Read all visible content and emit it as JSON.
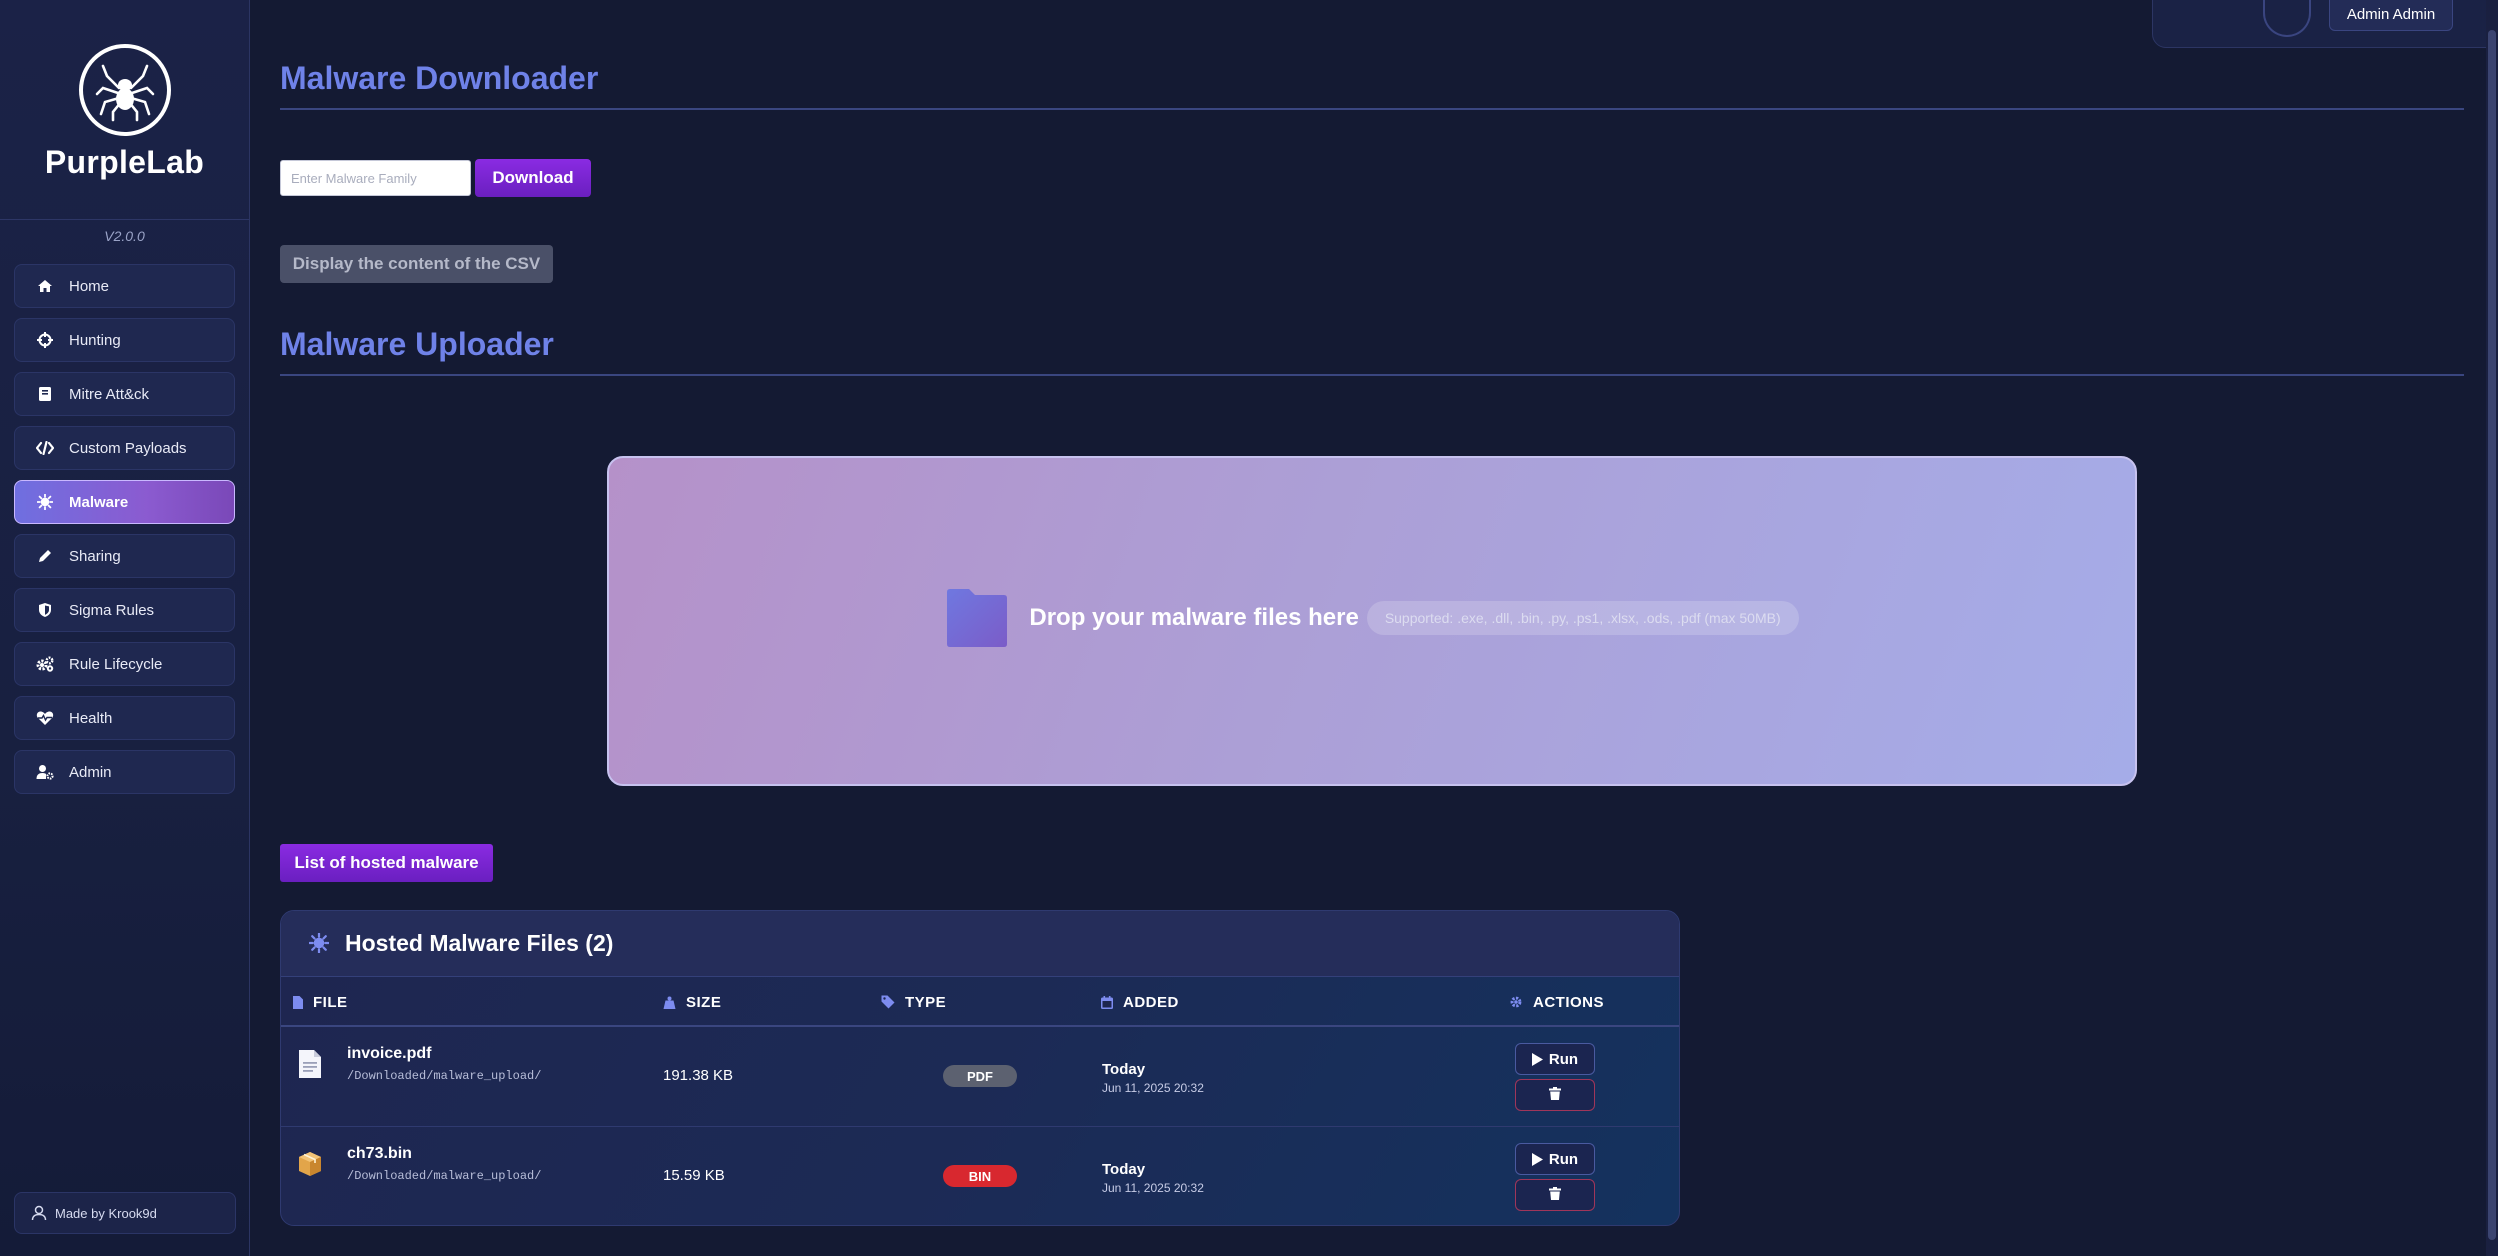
{
  "app": {
    "name": "PurpleLab",
    "version": "V2.0.0",
    "footer": "Made by Krook9d"
  },
  "user": {
    "button_label": "Admin Admin"
  },
  "sidebar": {
    "items": [
      {
        "label": "Home",
        "icon": "home-icon"
      },
      {
        "label": "Hunting",
        "icon": "crosshair-icon"
      },
      {
        "label": "Mitre Att&ck",
        "icon": "book-icon"
      },
      {
        "label": "Custom Payloads",
        "icon": "code-icon"
      },
      {
        "label": "Malware",
        "icon": "virus-icon",
        "active": true
      },
      {
        "label": "Sharing",
        "icon": "pencil-icon"
      },
      {
        "label": "Sigma Rules",
        "icon": "shield-icon"
      },
      {
        "label": "Rule Lifecycle",
        "icon": "cogs-icon"
      },
      {
        "label": "Health",
        "icon": "heartbeat-icon"
      },
      {
        "label": "Admin",
        "icon": "user-cog-icon"
      }
    ]
  },
  "downloader": {
    "title": "Malware Downloader",
    "input_placeholder": "Enter Malware Family",
    "download_label": "Download",
    "csv_label": "Display the content of the CSV"
  },
  "uploader": {
    "title": "Malware Uploader",
    "drop_text": "Drop your malware files here",
    "supported": "Supported: .exe, .dll, .bin, .py, .ps1, .xlsx, .ods, .pdf (max 50MB)"
  },
  "list_button_label": "List of hosted malware",
  "hosted": {
    "title": "Hosted Malware Files (2)",
    "columns": [
      "FILE",
      "SIZE",
      "TYPE",
      "ADDED",
      "ACTIONS"
    ],
    "run_label": "Run",
    "rows": [
      {
        "name": "invoice.pdf",
        "path": "/Downloaded/malware_upload/",
        "size": "191.38 KB",
        "type": "PDF",
        "type_color": "#5c6170",
        "added": "Today",
        "added_date": "Jun 11, 2025 20:32",
        "icon": "document-icon"
      },
      {
        "name": "ch73.bin",
        "path": "/Downloaded/malware_upload/",
        "size": "15.59 KB",
        "type": "BIN",
        "type_color": "#d8282f",
        "added": "Today",
        "added_date": "Jun 11, 2025 20:32",
        "icon": "package-icon"
      }
    ]
  }
}
